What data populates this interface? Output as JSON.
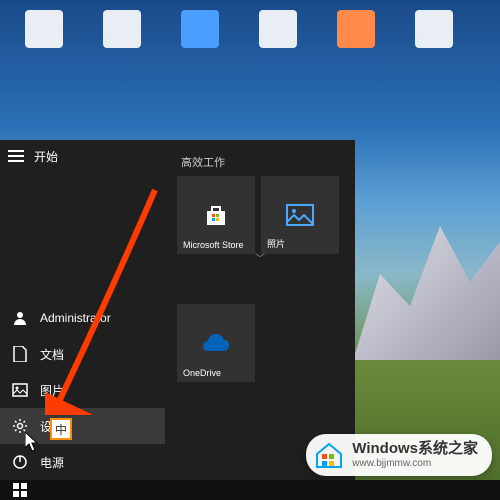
{
  "start_menu": {
    "header": "开始",
    "group_title": "高效工作",
    "tiles": [
      {
        "label": "Microsoft Store",
        "icon": "store"
      },
      {
        "label": "照片",
        "icon": "photos"
      },
      {
        "label": "OneDrive",
        "icon": "onedrive"
      }
    ],
    "left_items": {
      "user": "Administrator",
      "documents": "文档",
      "pictures": "图片",
      "settings": "设置",
      "power": "电源"
    }
  },
  "ime": {
    "indicator": "中"
  },
  "watermark": {
    "title": "Windows系统之家",
    "url": "www.bjjmmw.com"
  }
}
